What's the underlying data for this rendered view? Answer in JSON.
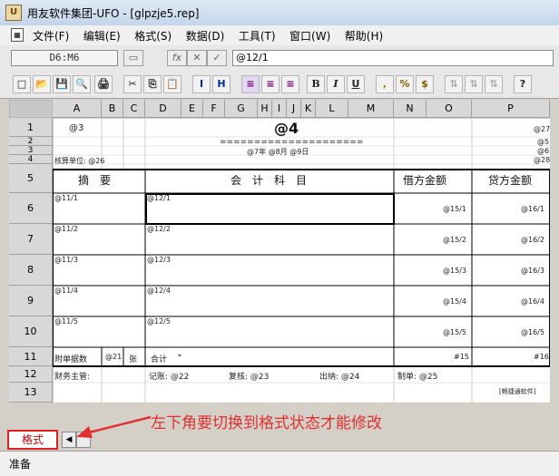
{
  "window": {
    "title": "用友软件集团-UFO - [glpzje5.rep]",
    "icon_label": "U"
  },
  "menu": {
    "items": [
      "文件(F)",
      "编辑(E)",
      "格式(S)",
      "数据(D)",
      "工具(T)",
      "窗口(W)",
      "帮助(H)"
    ]
  },
  "formula_bar": {
    "cell_ref": "D6:M6",
    "fx_label": "fx",
    "cancel_label": "✕",
    "ok_label": "✓",
    "formula": "@12/1"
  },
  "toolbar": {
    "items": [
      "□",
      "📂",
      "💾",
      "🔍",
      "🖨",
      "✂",
      "⎘",
      "📋",
      "I",
      "H",
      "≡",
      "≡",
      "≡",
      "B",
      "I",
      "U",
      ",",
      "%",
      "$",
      "⇅",
      "⇅",
      "⇅",
      "?"
    ]
  },
  "grid": {
    "columns": [
      "A",
      "B",
      "C",
      "D",
      "E",
      "F",
      "G",
      "H",
      "I",
      "J",
      "K",
      "L",
      "M",
      "N",
      "O",
      "P"
    ],
    "rows": [
      "1",
      "2",
      "3",
      "4",
      "5",
      "6",
      "7",
      "8",
      "9",
      "10",
      "11",
      "12",
      "13"
    ]
  },
  "report": {
    "r1_a": "@3",
    "r1_title": "@4",
    "r1_p": "@27",
    "r2_line": "=====================",
    "r2_p": "@5",
    "r3_date": "@7年 @8月 @9日",
    "r3_p": "@6",
    "r4_unit": "核算单位: @26",
    "r4_p": "@28",
    "h_summary": "摘　要",
    "h_subject": "会　计　科　目",
    "h_debit": "借方金额",
    "h_credit": "贷方金额",
    "rows": [
      {
        "a": "@11/1",
        "d": "@12/1",
        "n": "@15/1",
        "p": "@16/1"
      },
      {
        "a": "@11/2",
        "d": "@12/2",
        "n": "@15/2",
        "p": "@16/2"
      },
      {
        "a": "@11/3",
        "d": "@12/3",
        "n": "@15/3",
        "p": "@16/3"
      },
      {
        "a": "@11/4",
        "d": "@12/4",
        "n": "@15/4",
        "p": "@16/4"
      },
      {
        "a": "@11/5",
        "d": "@12/5",
        "n": "@15/5",
        "p": "@16/5"
      }
    ],
    "r11_label": "附单据数",
    "r11_count": "@21",
    "r11_unit": "张",
    "r11_total": "合计",
    "r11_star": "*",
    "r11_n": "#15",
    "r11_p": "#16",
    "r12_manager": "财务主管:",
    "r12_bookkeep": "记账: @22",
    "r12_review": "复核: @23",
    "r12_cashier": "出纳: @24",
    "r12_maker": "制单: @25",
    "r13_p": "[畅捷通软件]"
  },
  "sheet_tab": {
    "label": "格式"
  },
  "annotation": {
    "text": "左下角要切换到格式状态才能修改"
  },
  "status": {
    "text": "准备"
  }
}
